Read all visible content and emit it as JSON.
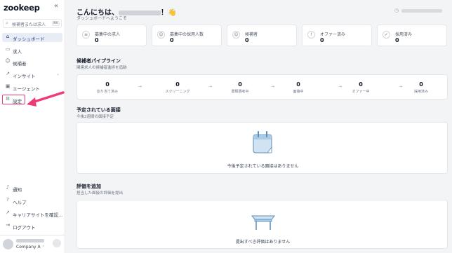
{
  "app": {
    "logo": "zookeep",
    "collapse_icon": "«"
  },
  "search": {
    "placeholder": "候補者または求人",
    "shortcut": "⌘K"
  },
  "nav": {
    "items": [
      {
        "label": "ダッシュボード",
        "icon": "home-icon",
        "glyph": "⌂",
        "active": true
      },
      {
        "label": "求人",
        "icon": "briefcase-icon",
        "glyph": "▭"
      },
      {
        "label": "候補者",
        "icon": "user-icon",
        "glyph": "☺"
      },
      {
        "label": "インサイト",
        "icon": "chart-icon",
        "glyph": "↗",
        "chevron": "⌄"
      },
      {
        "label": "エージェント",
        "icon": "agent-icon",
        "glyph": "▣"
      },
      {
        "label": "設定",
        "icon": "gear-icon",
        "glyph": "⚙"
      }
    ],
    "bottom": [
      {
        "label": "通知",
        "icon": "bell-icon",
        "glyph": "♪"
      },
      {
        "label": "ヘルプ",
        "icon": "help-icon",
        "glyph": "?"
      },
      {
        "label": "キャリアサイトを確認...",
        "icon": "external-link-icon",
        "glyph": "↗"
      },
      {
        "label": "ログアウト",
        "icon": "logout-icon",
        "glyph": "⇥"
      }
    ]
  },
  "user": {
    "company": "Company A",
    "chevron": "⌃"
  },
  "main": {
    "greeting_prefix": "こんにちは、",
    "greeting_suffix": "！👋",
    "greeting_sub": "ダッシュボードへようこそ",
    "stats": [
      {
        "label": "募集中の求人",
        "value": "0",
        "icon": "document-icon",
        "glyph": "≡"
      },
      {
        "label": "募集中の採用人数",
        "value": "0",
        "icon": "user-circle-icon",
        "glyph": "☺"
      },
      {
        "label": "候補者",
        "value": "0",
        "icon": "users-icon",
        "glyph": "☺"
      },
      {
        "label": "オファー済み",
        "value": "0",
        "icon": "warning-icon",
        "glyph": "!"
      },
      {
        "label": "採用済み",
        "value": "0",
        "icon": "check-circle-icon",
        "glyph": "✓"
      }
    ],
    "pipeline": {
      "title": "候補者パイプライン",
      "subtitle": "関連求人の候補者進捗を追跡",
      "stages": [
        {
          "value": "0",
          "label": "割り当て済み"
        },
        {
          "value": "0",
          "label": "スクリーニング"
        },
        {
          "value": "0",
          "label": "書類選考中"
        },
        {
          "value": "0",
          "label": "面接中"
        },
        {
          "value": "0",
          "label": "オファー中"
        },
        {
          "value": "0",
          "label": "採用済み"
        }
      ],
      "arrow": "→"
    },
    "interviews": {
      "title": "予定されている面接",
      "subtitle": "今後2週間の面接予定",
      "empty": "今後予定されている面接はありません"
    },
    "evaluations": {
      "title": "評価を追加",
      "subtitle": "担当した面接の評価を提出",
      "empty": "提出すべき評価はありません"
    }
  },
  "colors": {
    "accent": "#1e3a8a",
    "active_bg": "#e8edf5",
    "highlight": "#ef3a74",
    "illustration": "#cfe3f2"
  }
}
